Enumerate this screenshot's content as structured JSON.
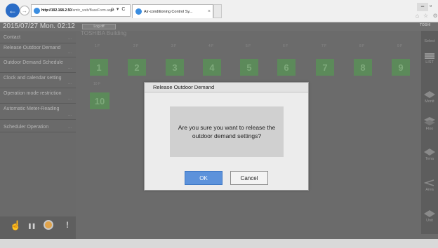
{
  "browser": {
    "url_host": "http://192.168.2.50",
    "url_path": "/amtc_web/BaseForm.aspx",
    "url_controls": "ρ ▾ C",
    "tab_title": "Air-conditioning Control Sy...",
    "tab_close": "×",
    "back_icon": "←",
    "forward_icon": "→",
    "min_icon": "−",
    "max_icon": "▫",
    "toolbar_icons": "⌂ ☆ ⚙"
  },
  "header": {
    "datetime": "2015/07/27  Mon.  02:12",
    "logout_label": "Log off",
    "brand": "TOSHI",
    "building": "TOSHIBA Building"
  },
  "sidebar": {
    "dots": "...",
    "items": [
      {
        "label": "Contact"
      },
      {
        "label": "Release Outdoor Demand"
      },
      {
        "label": "Outdoor Demand Schedule"
      },
      {
        "label": "Clock and calendar setting"
      },
      {
        "label": "Operation mode restriction"
      },
      {
        "label": "Automatic Meter-Reading"
      },
      {
        "label": "Scheduler Operation"
      }
    ]
  },
  "floors": [
    {
      "label": "1 F",
      "number": "1"
    },
    {
      "label": "2 F",
      "number": "2"
    },
    {
      "label": "3 F",
      "number": "3"
    },
    {
      "label": "4 F",
      "number": "4"
    },
    {
      "label": "5 F",
      "number": "5"
    },
    {
      "label": "6 F",
      "number": "6"
    },
    {
      "label": "7 F",
      "number": "7"
    },
    {
      "label": "8 F",
      "number": "8"
    },
    {
      "label": "9 F",
      "number": "9"
    },
    {
      "label": "10 F",
      "number": "10"
    }
  ],
  "right_panel": {
    "top_label": "Select",
    "items": [
      {
        "label": "LIST",
        "icon": "list-icon"
      },
      {
        "label": "Monit",
        "icon": "monitor-icon"
      },
      {
        "label": "Floo",
        "icon": "floor-icon"
      },
      {
        "label": "Tena",
        "icon": "tenant-icon"
      },
      {
        "label": "Area",
        "icon": "area-icon"
      },
      {
        "label": "Unit",
        "icon": "unit-icon"
      }
    ]
  },
  "bottom_icons": [
    {
      "name": "hand-icon",
      "glyph": "☝"
    },
    {
      "name": "pause-icon",
      "glyph": "❚❚"
    },
    {
      "name": "sun-icon",
      "glyph": "●"
    },
    {
      "name": "alert-icon",
      "glyph": "!"
    }
  ],
  "dialog": {
    "title": "Release Outdoor Demand",
    "message": "Are you sure you want to release the outdoor demand settings?",
    "ok_label": "OK",
    "cancel_label": "Cancel"
  },
  "colors": {
    "accent": "#5c92db",
    "floor_tile": "#5c8a5a",
    "background": "#6b6b6b"
  }
}
